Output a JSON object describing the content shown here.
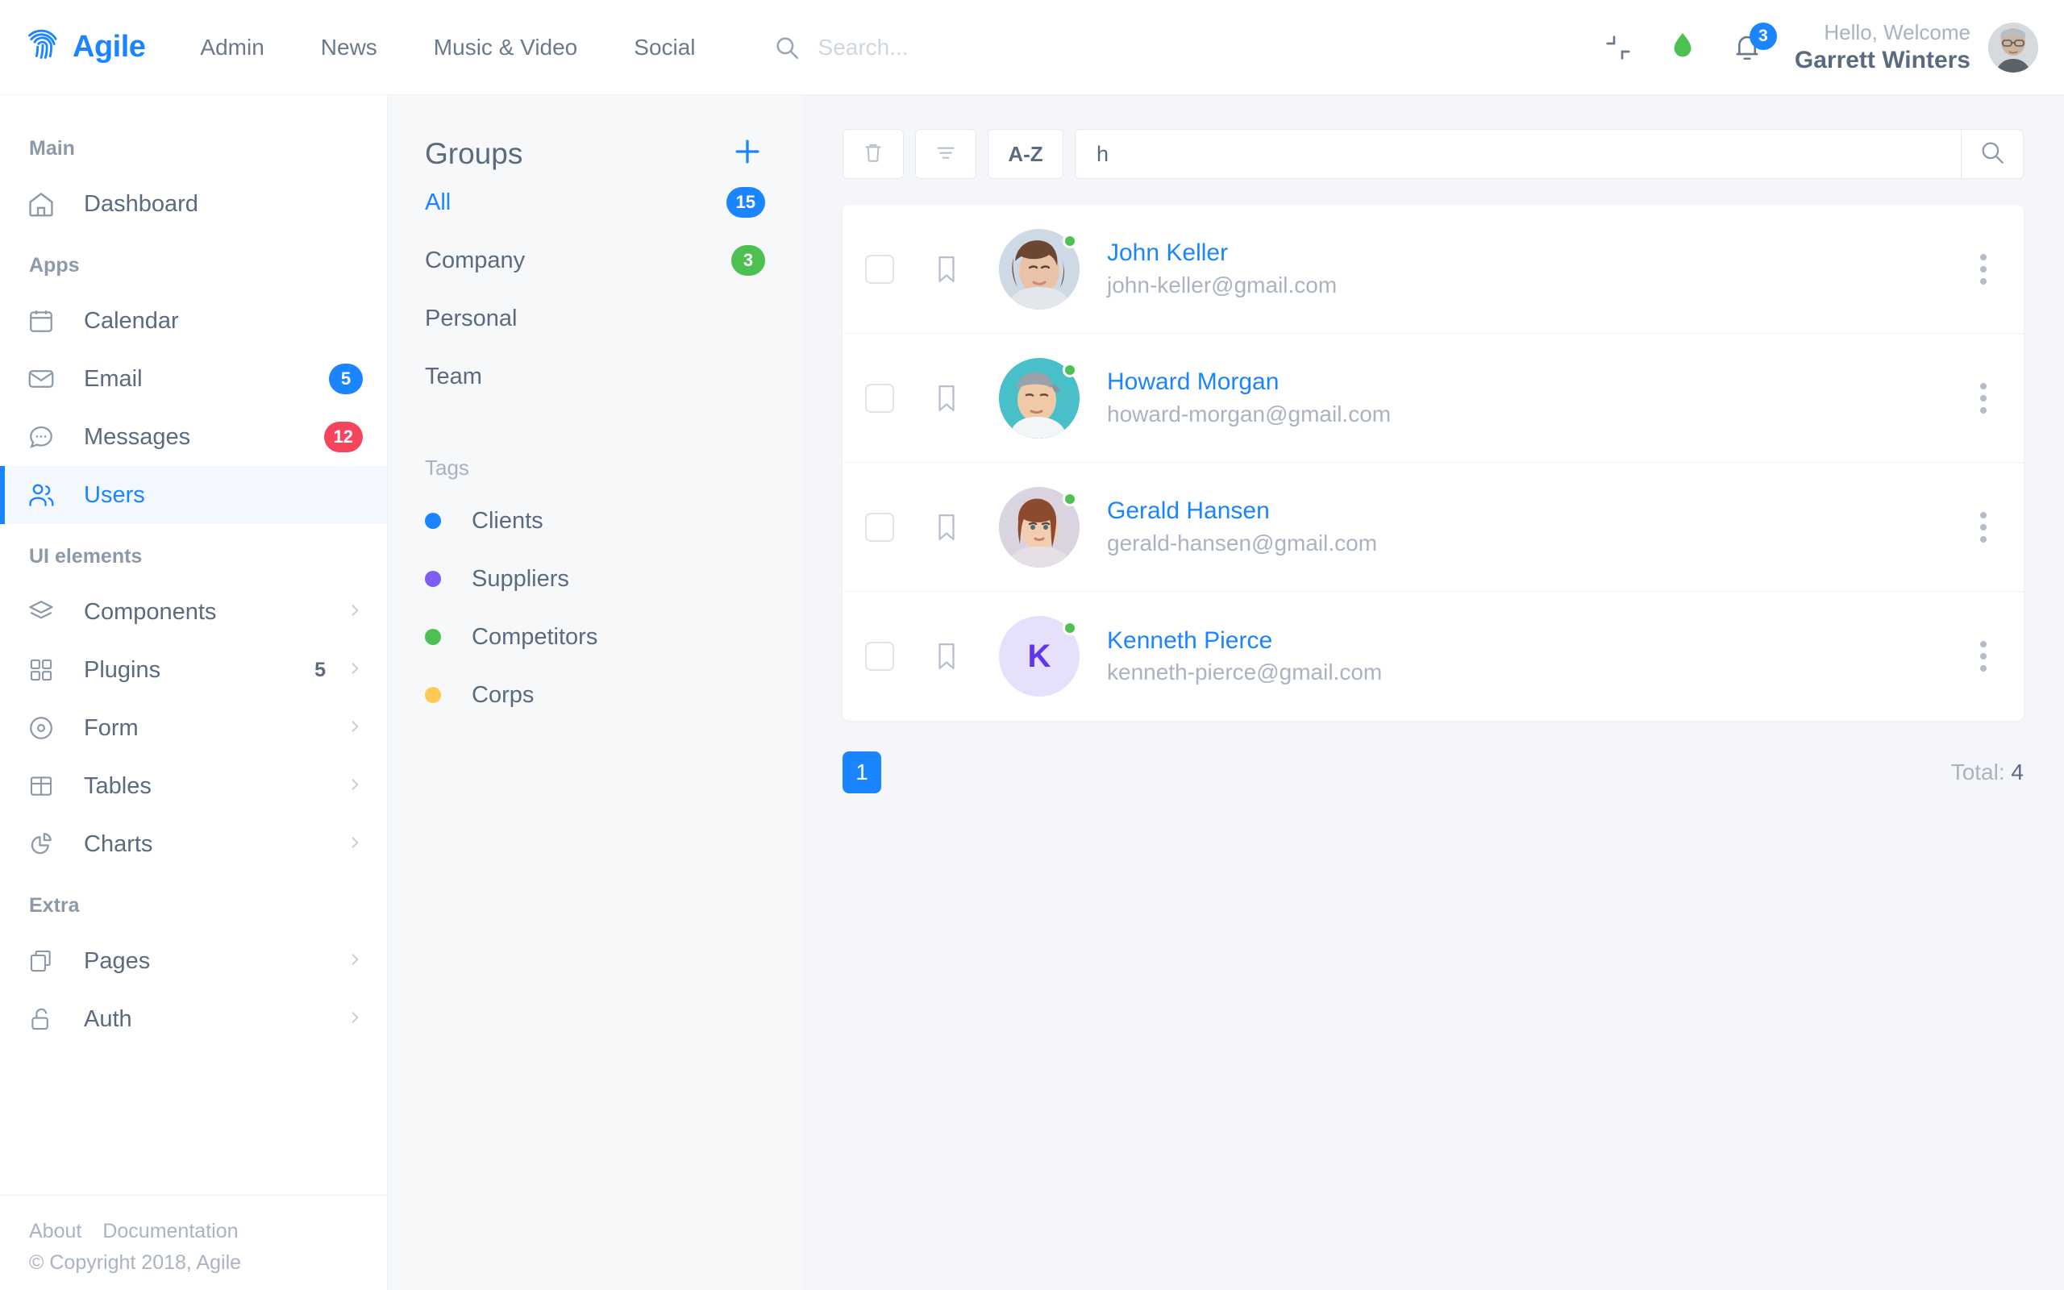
{
  "brand": {
    "name": "Agile",
    "logo_icon": "fingerprint-icon"
  },
  "topnav": [
    {
      "label": "Admin"
    },
    {
      "label": "News"
    },
    {
      "label": "Music & Video"
    },
    {
      "label": "Social"
    }
  ],
  "header_search": {
    "value": "",
    "placeholder": "Search...",
    "icon": "search-icon"
  },
  "header_actions": {
    "fullscreen_icon": "collapse-fullscreen-icon",
    "drop_icon": "water-drop-icon",
    "bell_icon": "bell-icon",
    "bell_badge": "3"
  },
  "user": {
    "greeting": "Hello, Welcome",
    "name": "Garrett Winters",
    "avatar_icon": "user-avatar"
  },
  "sidebar": {
    "sections": [
      {
        "label": "Main",
        "items": [
          {
            "label": "Dashboard",
            "icon": "home-icon",
            "badge": null,
            "badge_color": null,
            "count": null,
            "chevron": false,
            "active": false
          }
        ]
      },
      {
        "label": "Apps",
        "items": [
          {
            "label": "Calendar",
            "icon": "calendar-icon",
            "badge": null,
            "badge_color": null,
            "count": null,
            "chevron": false,
            "active": false
          },
          {
            "label": "Email",
            "icon": "envelope-icon",
            "badge": "5",
            "badge_color": "blue",
            "count": null,
            "chevron": false,
            "active": false
          },
          {
            "label": "Messages",
            "icon": "chat-bubble-icon",
            "badge": "12",
            "badge_color": "red",
            "count": null,
            "chevron": false,
            "active": false
          },
          {
            "label": "Users",
            "icon": "users-icon",
            "badge": null,
            "badge_color": null,
            "count": null,
            "chevron": false,
            "active": true
          }
        ]
      },
      {
        "label": "UI elements",
        "items": [
          {
            "label": "Components",
            "icon": "layers-icon",
            "badge": null,
            "badge_color": null,
            "count": null,
            "chevron": true,
            "active": false
          },
          {
            "label": "Plugins",
            "icon": "grid-squares-icon",
            "badge": null,
            "badge_color": null,
            "count": "5",
            "chevron": true,
            "active": false
          },
          {
            "label": "Form",
            "icon": "radio-circle-icon",
            "badge": null,
            "badge_color": null,
            "count": null,
            "chevron": true,
            "active": false
          },
          {
            "label": "Tables",
            "icon": "table-icon",
            "badge": null,
            "badge_color": null,
            "count": null,
            "chevron": true,
            "active": false
          },
          {
            "label": "Charts",
            "icon": "pie-chart-icon",
            "badge": null,
            "badge_color": null,
            "count": null,
            "chevron": true,
            "active": false
          }
        ]
      },
      {
        "label": "Extra",
        "items": [
          {
            "label": "Pages",
            "icon": "copy-pages-icon",
            "badge": null,
            "badge_color": null,
            "count": null,
            "chevron": true,
            "active": false
          },
          {
            "label": "Auth",
            "icon": "unlock-icon",
            "badge": null,
            "badge_color": null,
            "count": null,
            "chevron": true,
            "active": false
          }
        ]
      }
    ],
    "footer": {
      "links": [
        {
          "label": "About"
        },
        {
          "label": "Documentation"
        }
      ],
      "copyright": "© Copyright 2018, Agile"
    }
  },
  "groups": {
    "title": "Groups",
    "add_icon": "plus-icon",
    "items": [
      {
        "label": "All",
        "badge": "15",
        "badge_color": "blue",
        "active": true
      },
      {
        "label": "Company",
        "badge": "3",
        "badge_color": "green",
        "active": false
      },
      {
        "label": "Personal",
        "badge": null,
        "badge_color": null,
        "active": false
      },
      {
        "label": "Team",
        "badge": null,
        "badge_color": null,
        "active": false
      }
    ],
    "tags_label": "Tags",
    "tags": [
      {
        "label": "Clients",
        "color": "#1b84ff"
      },
      {
        "label": "Suppliers",
        "color": "#7d5ef5"
      },
      {
        "label": "Competitors",
        "color": "#4cc152"
      },
      {
        "label": "Corps",
        "color": "#ffc council"
      }
    ]
  },
  "toolbar": {
    "delete_icon": "trash-icon",
    "filter_icon": "filter-icon",
    "sort_label": "A-Z",
    "search_value": "h",
    "search_placeholder": "",
    "search_icon": "search-icon"
  },
  "users_list": [
    {
      "name": "John Keller",
      "email": "john-keller@gmail.com",
      "avatar_type": "photo",
      "avatar_bg": "#cfd8e3",
      "initial": "",
      "online": true
    },
    {
      "name": "Howard Morgan",
      "email": "howard-morgan@gmail.com",
      "avatar_type": "photo",
      "avatar_bg": "#4cbfc9",
      "initial": "",
      "online": true
    },
    {
      "name": "Gerald Hansen",
      "email": "gerald-hansen@gmail.com",
      "avatar_type": "photo",
      "avatar_bg": "#d8d3de",
      "initial": "",
      "online": true
    },
    {
      "name": "Kenneth Pierce",
      "email": "kenneth-pierce@gmail.com",
      "avatar_type": "initial",
      "avatar_bg": "#e6e0fb",
      "initial": "K",
      "online": true
    }
  ],
  "pagination": {
    "current_page": "1"
  },
  "total": {
    "label": "Total:",
    "value": "4"
  },
  "colors": {
    "accent": "#1b84ff",
    "danger": "#f5455c",
    "success": "#4cc152",
    "text": "#5a6b80",
    "muted": "#aab3c0",
    "bg": "#f4f6f9",
    "panel_bg": "#f6f8fa"
  }
}
